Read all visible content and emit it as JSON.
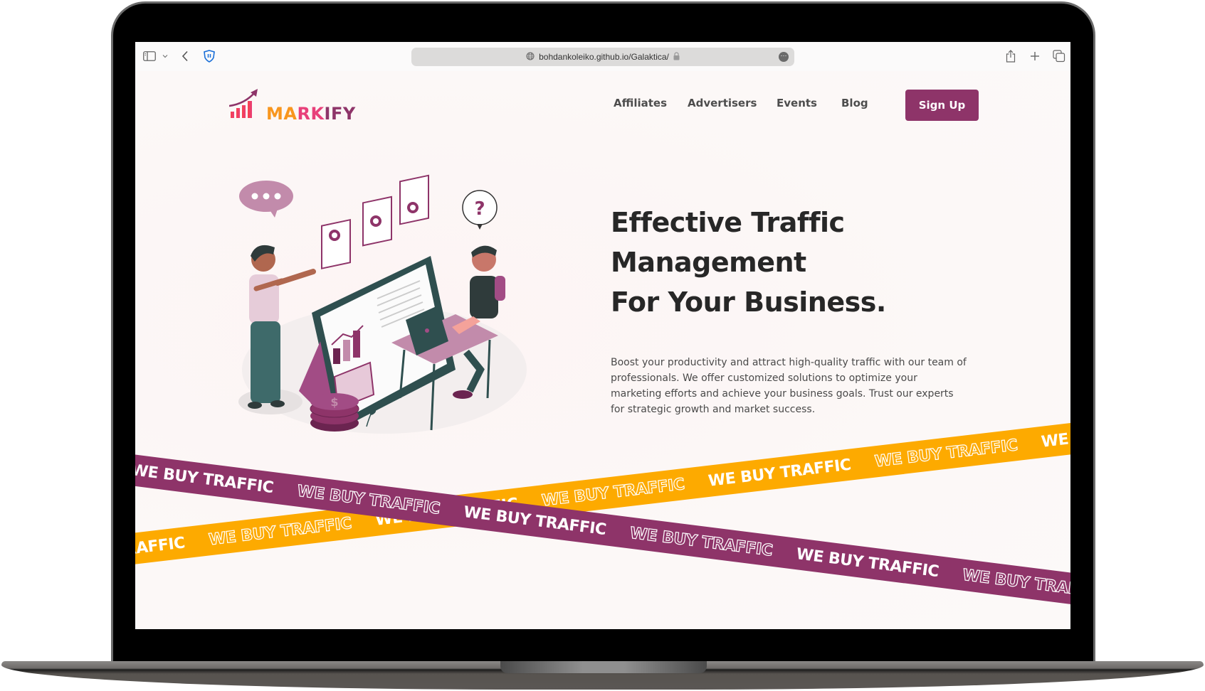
{
  "browser": {
    "url": "bohdankoleiko.github.io/Galaktica/",
    "icons": {
      "sidebar": "sidebar-icon",
      "chevron": "chevron-down-icon",
      "back": "back-arrow-icon",
      "shield": "privacy-shield-icon",
      "globe": "globe-icon",
      "lock": "lock-icon",
      "more": "more-icon",
      "share": "share-icon",
      "new_tab": "plus-icon",
      "tabs": "tabs-overview-icon"
    }
  },
  "brand": {
    "name_part1": "MA",
    "name_part2": "RK",
    "name_part3": "IFY",
    "colors": {
      "primary": "#8e3469",
      "accent": "#fdaa00",
      "orange": "#f8961e",
      "pink": "#e8407a"
    }
  },
  "nav": {
    "items": [
      {
        "label": "Affiliates"
      },
      {
        "label": "Advertisers"
      },
      {
        "label": "Events"
      },
      {
        "label": "Blog"
      }
    ],
    "cta_label": "Sign Up"
  },
  "hero": {
    "title_line1": "Effective Traffic",
    "title_line2": "Management",
    "title_line3": "For Your Business.",
    "description": "Boost your productivity and attract high-quality traffic with our team of professionals. We offer customized solutions to optimize your marketing efforts and achieve your business goals. Trust our experts for strategic growth and market success.",
    "illustration": "team-presentation-illustration"
  },
  "ribbons": {
    "text": "WE BUY TRAFFIC"
  }
}
